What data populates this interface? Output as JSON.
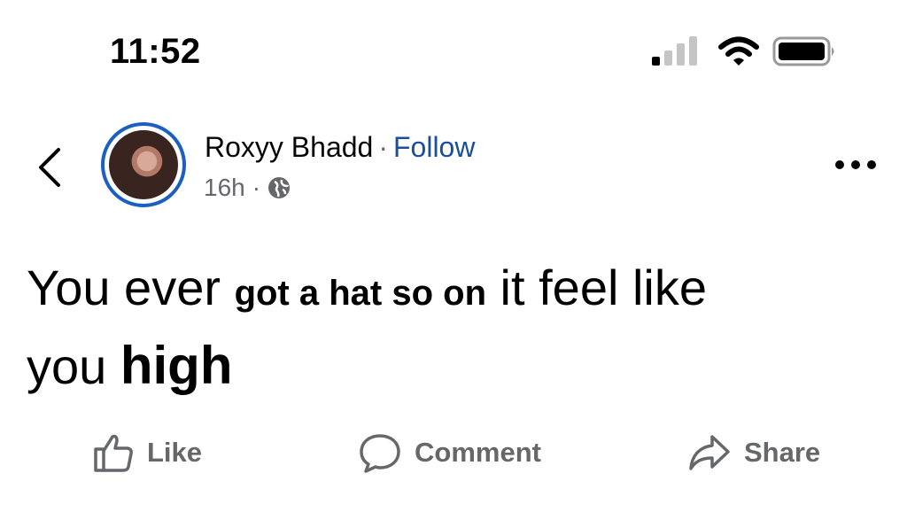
{
  "status_bar": {
    "time": "11:52",
    "signal_icon": "cellular-signal-icon",
    "wifi_icon": "wifi-icon",
    "battery_icon": "battery-icon"
  },
  "post": {
    "back_icon": "chevron-left-icon",
    "author_name": "Roxyy Bhadd",
    "separator": "·",
    "follow_label": "Follow",
    "timestamp": "16h",
    "meta_separator": "·",
    "audience_icon": "globe-icon",
    "more_icon": "more-options-icon",
    "text_parts": {
      "p1": "You ever ",
      "p2": "got a hat so on",
      "p3": " it feel like",
      "p4": "you ",
      "p5": "high"
    }
  },
  "actions": {
    "like_label": "Like",
    "like_icon": "thumbs-up-icon",
    "comment_label": "Comment",
    "comment_icon": "comment-bubble-icon",
    "share_label": "Share",
    "share_icon": "share-arrow-icon"
  },
  "colors": {
    "follow_link": "#1a4f9c",
    "avatar_ring": "#1b5fc0",
    "muted_text": "#65676b"
  }
}
